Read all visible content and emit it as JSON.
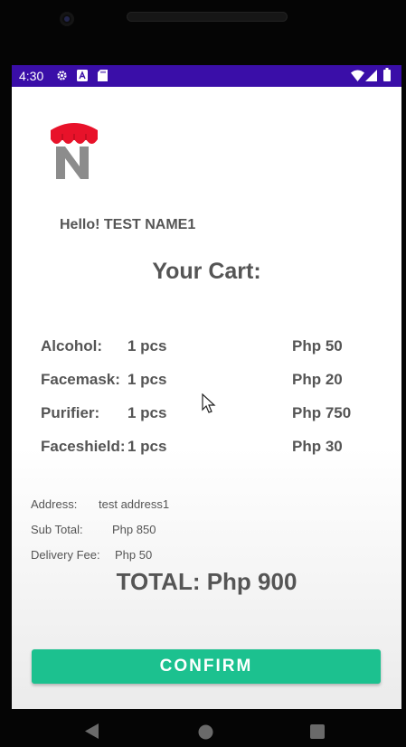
{
  "status": {
    "time": "4:30"
  },
  "greeting": "Hello! TEST NAME1",
  "cart_title": "Your Cart:",
  "items": [
    {
      "name": "Alcohol:",
      "qty": "1 pcs",
      "price": "Php  50"
    },
    {
      "name": "Facemask:",
      "qty": "1 pcs",
      "price": "Php  20"
    },
    {
      "name": "Purifier:",
      "qty": "1 pcs",
      "price": "Php  750"
    },
    {
      "name": "Faceshield:",
      "qty": "1 pcs",
      "price": "Php  30"
    }
  ],
  "address": {
    "label": "Address:",
    "value": "test address1"
  },
  "subtotal": {
    "label": "Sub Total:",
    "value": "Php  850"
  },
  "delivery": {
    "label": "Delivery Fee:",
    "value": "Php  50"
  },
  "total": "TOTAL:  Php  900",
  "confirm_label": "CONFIRM",
  "colors": {
    "status_bar": "#3a0ea8",
    "confirm": "#1cc18f",
    "logo_red": "#e8122a",
    "logo_gray": "#8c8c8c"
  }
}
